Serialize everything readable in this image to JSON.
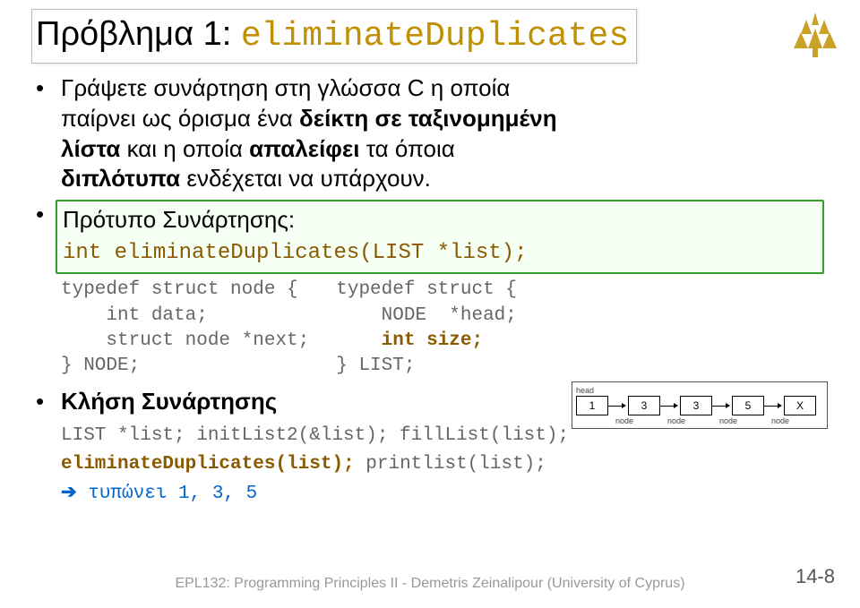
{
  "title": {
    "pre": "Πρόβλημα 1: ",
    "code": "eliminateDuplicates"
  },
  "b1": {
    "l1a": "Γράψετε συνάρτηση στη γλώσσα C η οποία",
    "l2a": "παίρνει ως όρισμα ένα ",
    "l2b": "δείκτη σε ταξινομημένη",
    "l3a": "λίστα",
    "l3b": " και η οποία ",
    "l3c": "απαλείφει",
    "l3d": " τα όποια",
    "l4a": "διπλότυπα",
    "l4b": " ενδέχεται να υπάρχουν."
  },
  "b2": {
    "head": "Πρότυπο Συνάρτησης:",
    "proto": "int eliminateDuplicates(LIST *list);"
  },
  "codeL": "typedef struct node {\n    int data;\n    struct node *next;\n} NODE;",
  "codeR_l1": "typedef struct {",
  "codeR_l2": "    NODE  *head;",
  "codeR_l3pre": "    ",
  "codeR_l3emph": "int size;",
  "codeR_l4": "} LIST;",
  "b3": {
    "head": "Κλήση Συνάρτησης"
  },
  "call": {
    "l1": "LIST *list; initList2(&list); fillList(list);",
    "l2": "eliminateDuplicates(list);",
    "l2b": " printlist(list);",
    "l3sym": "➔",
    "l3txt": " τυπώνει 1, 3, 5"
  },
  "diagram": {
    "head": "head",
    "vals": [
      "1",
      "3",
      "3",
      "5",
      "X"
    ],
    "node": "node"
  },
  "footer": "EPL132: Programming Principles II - Demetris Zeinalipour (University of Cyprus)",
  "pagenum": "14-8"
}
